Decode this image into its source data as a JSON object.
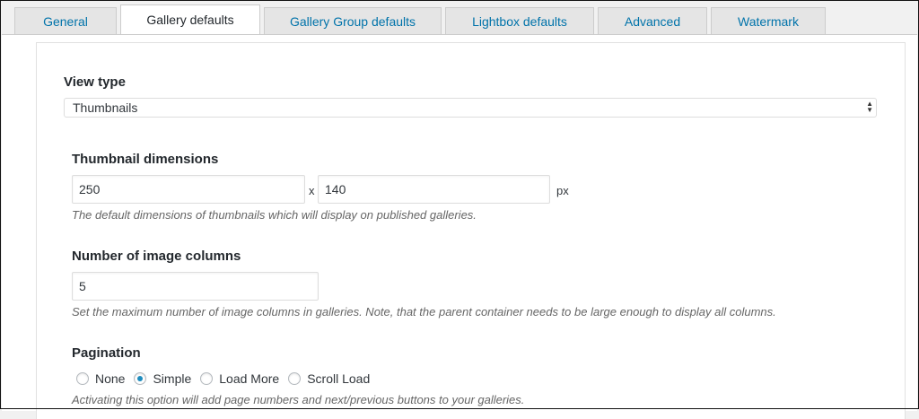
{
  "tabs": [
    {
      "label": "General",
      "active": false
    },
    {
      "label": "Gallery defaults",
      "active": true
    },
    {
      "label": "Gallery Group defaults",
      "active": false
    },
    {
      "label": "Lightbox defaults",
      "active": false
    },
    {
      "label": "Advanced",
      "active": false
    },
    {
      "label": "Watermark",
      "active": false
    }
  ],
  "view_type": {
    "label": "View type",
    "selected": "Thumbnails"
  },
  "thumbnail_dimensions": {
    "label": "Thumbnail dimensions",
    "width": "250",
    "separator": "x",
    "height": "140",
    "unit": "px",
    "description": "The default dimensions of thumbnails which will display on published galleries."
  },
  "image_columns": {
    "label": "Number of image columns",
    "value": "5",
    "description": "Set the maximum number of image columns in galleries. Note, that the parent container needs to be large enough to display all columns."
  },
  "pagination": {
    "label": "Pagination",
    "options": [
      {
        "label": "None",
        "checked": false
      },
      {
        "label": "Simple",
        "checked": true
      },
      {
        "label": "Load More",
        "checked": false
      },
      {
        "label": "Scroll Load",
        "checked": false
      }
    ],
    "description": "Activating this option will add page numbers and next/previous buttons to your galleries."
  },
  "colors": {
    "link": "#0073aa",
    "radio_accent": "#1e8cbe"
  }
}
